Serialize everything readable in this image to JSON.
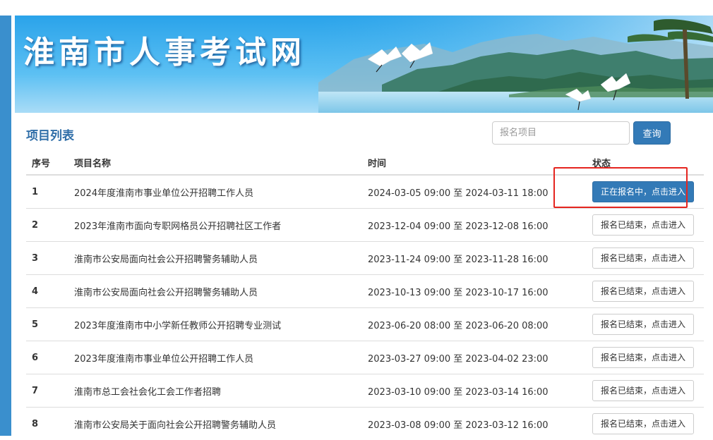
{
  "header": {
    "site_title": "淮南市人事考试网"
  },
  "section": {
    "title": "项目列表"
  },
  "search": {
    "placeholder": "报名项目",
    "button_label": "查询"
  },
  "table": {
    "columns": [
      "序号",
      "项目名称",
      "时间",
      "状态"
    ],
    "rows": [
      {
        "num": "1",
        "name": "2024年度淮南市事业单位公开招聘工作人员",
        "time": "2024-03-05 09:00 至 2024-03-11 18:00",
        "status": "正在报名中，点击进入",
        "active": true
      },
      {
        "num": "2",
        "name": "2023年淮南市面向专职网格员公开招聘社区工作者",
        "time": "2023-12-04 09:00 至 2023-12-08 16:00",
        "status": "报名已结束，点击进入",
        "active": false
      },
      {
        "num": "3",
        "name": "淮南市公安局面向社会公开招聘警务辅助人员",
        "time": "2023-11-24 09:00 至 2023-11-28 16:00",
        "status": "报名已结束，点击进入",
        "active": false
      },
      {
        "num": "4",
        "name": "淮南市公安局面向社会公开招聘警务辅助人员",
        "time": "2023-10-13 09:00 至 2023-10-17 16:00",
        "status": "报名已结束，点击进入",
        "active": false
      },
      {
        "num": "5",
        "name": "2023年度淮南市中小学新任教师公开招聘专业测试",
        "time": "2023-06-20 08:00 至 2023-06-20 08:00",
        "status": "报名已结束，点击进入",
        "active": false
      },
      {
        "num": "6",
        "name": "2023年度淮南市事业单位公开招聘工作人员",
        "time": "2023-03-27 09:00 至 2023-04-02 23:00",
        "status": "报名已结束，点击进入",
        "active": false
      },
      {
        "num": "7",
        "name": "淮南市总工会社会化工会工作者招聘",
        "time": "2023-03-10 09:00 至 2023-03-14 16:00",
        "status": "报名已结束，点击进入",
        "active": false
      },
      {
        "num": "8",
        "name": "淮南市公安局关于面向社会公开招聘警务辅助人员",
        "time": "2023-03-08 09:00 至 2023-03-12 16:00",
        "status": "报名已结束，点击进入",
        "active": false
      }
    ]
  },
  "colors": {
    "primary": "#337ab7",
    "title_blue": "#2f6ea8",
    "side_bar": "#3a8fcd",
    "highlight_red": "#e5251f"
  }
}
